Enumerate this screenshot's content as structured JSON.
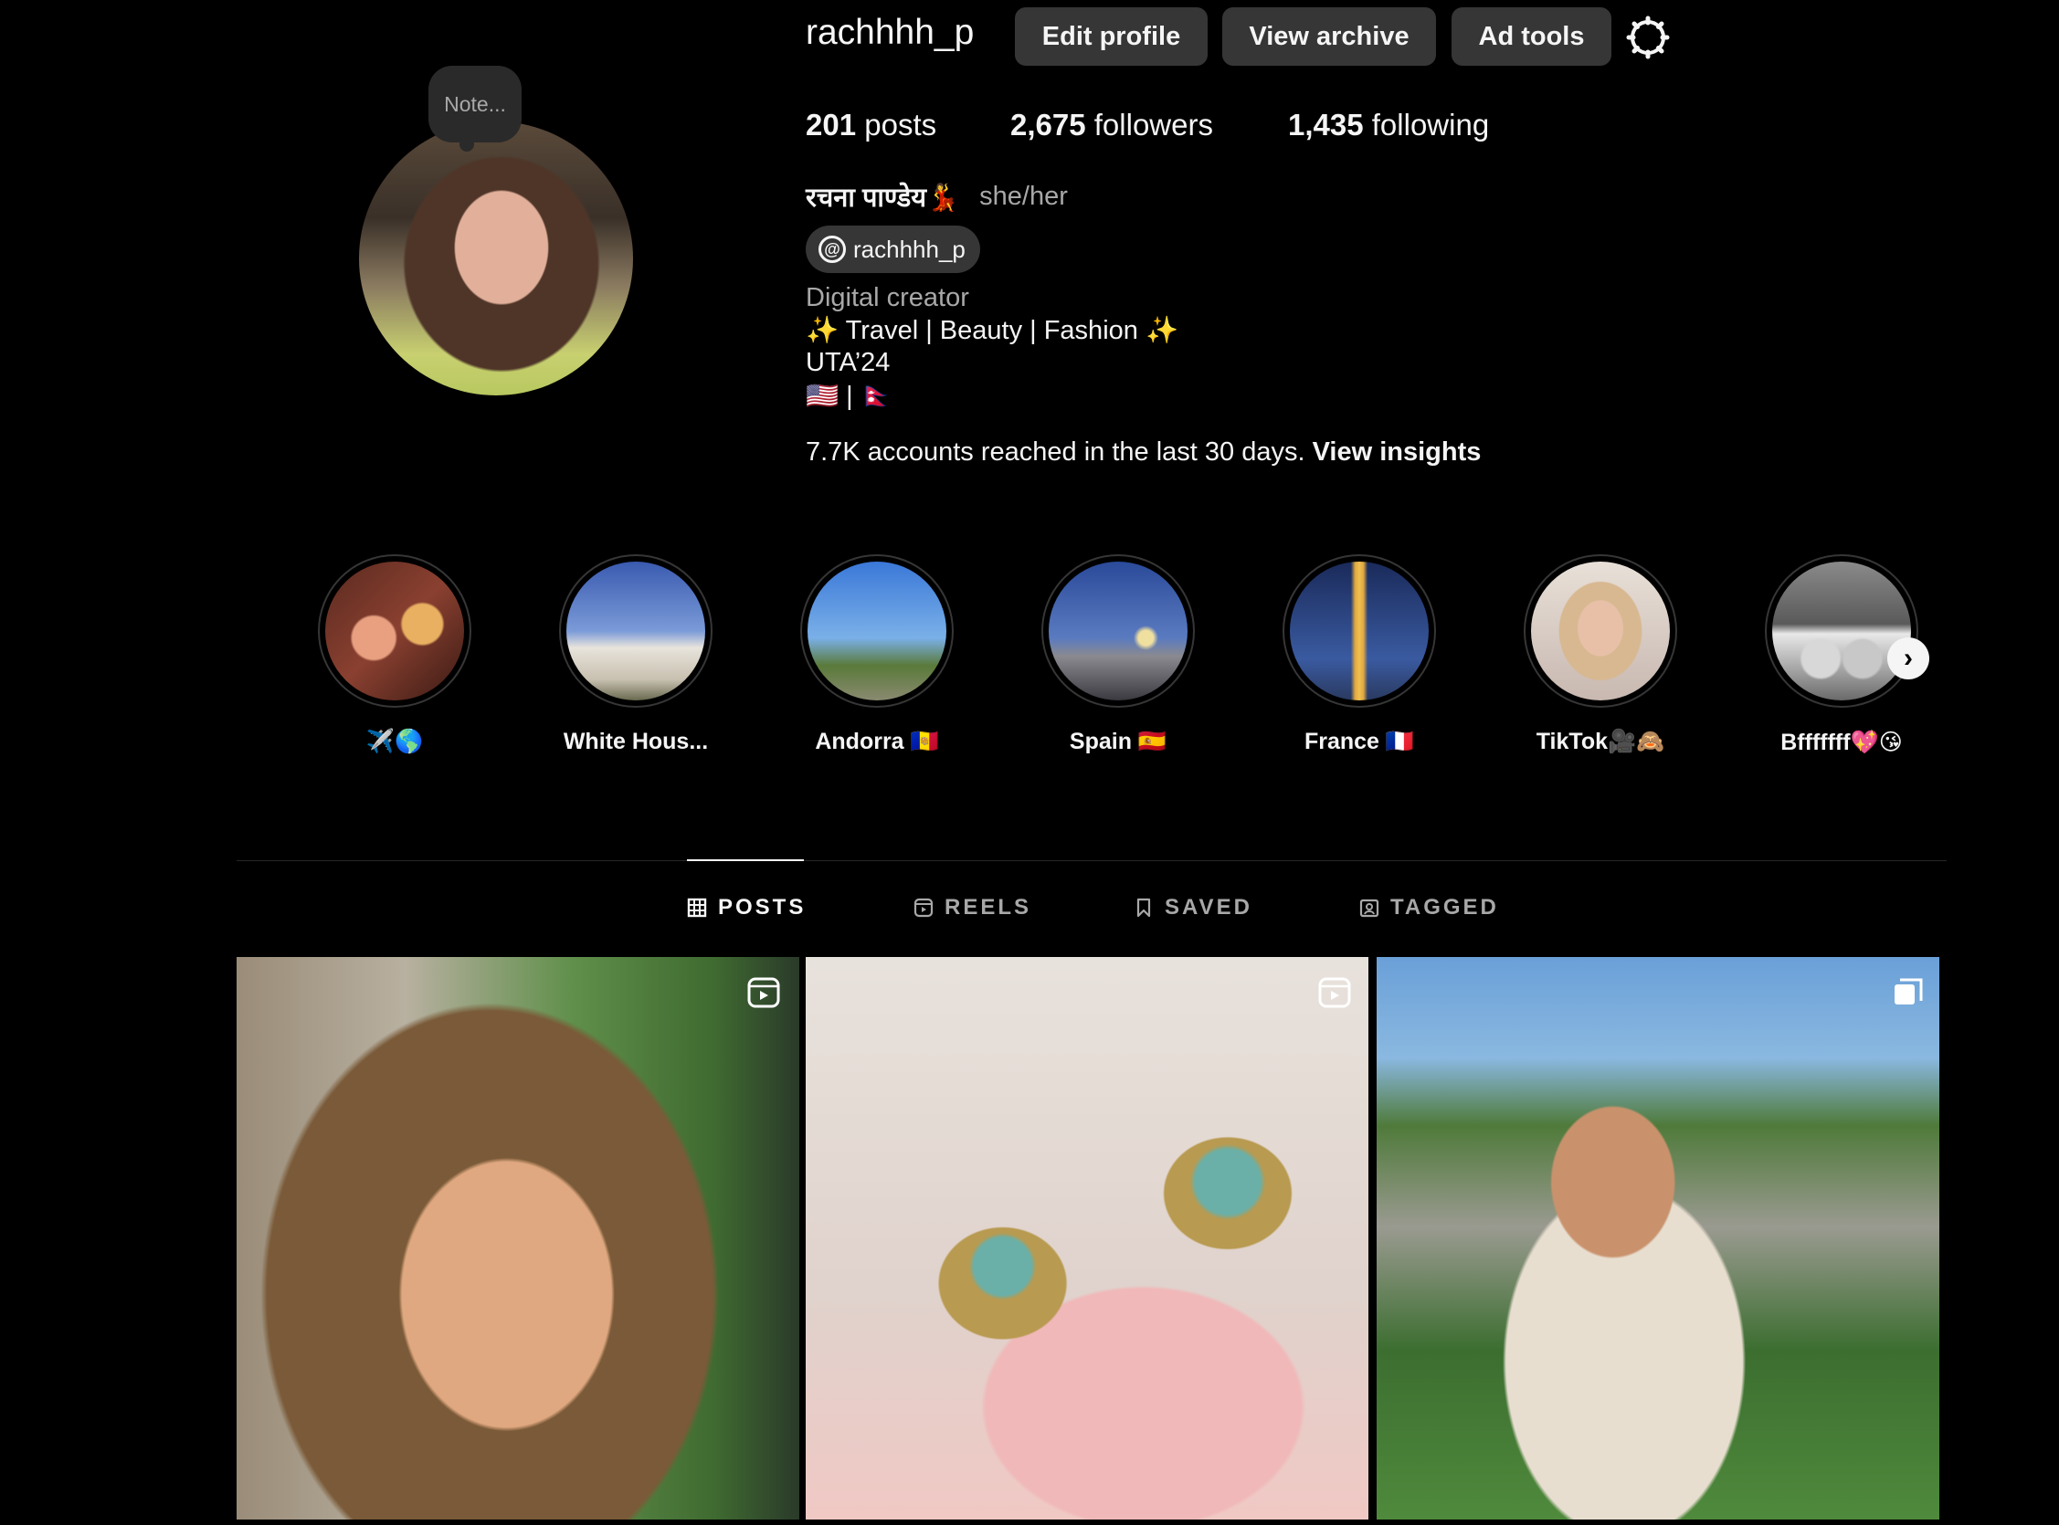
{
  "profile": {
    "username": "rachhhh_p",
    "note": "Note...",
    "fullname": "रचना पाण्डेय💃",
    "pronouns": "she/her",
    "threads_handle": "rachhhh_p",
    "category": "Digital creator",
    "bio_lines": [
      "✨ Travel | Beauty | Fashion ✨",
      "UTA’24",
      "🇺🇸 | 🇳🇵"
    ],
    "insights_text": "7.7K accounts reached in the last 30 days.",
    "insights_link": "View insights"
  },
  "actions": {
    "edit_profile": "Edit profile",
    "view_archive": "View archive",
    "ad_tools": "Ad tools",
    "settings_icon": "gear-icon"
  },
  "stats": {
    "posts_count": "201",
    "posts_label": "posts",
    "followers_count": "2,675",
    "followers_label": "followers",
    "following_count": "1,435",
    "following_label": "following"
  },
  "highlights": [
    {
      "label": "✈️🌎"
    },
    {
      "label": "White Hous..."
    },
    {
      "label": "Andorra 🇦🇩"
    },
    {
      "label": "Spain 🇪🇸"
    },
    {
      "label": "France 🇫🇷"
    },
    {
      "label": "TikTok🎥🙈"
    },
    {
      "label": "Bfffffff💖😘"
    }
  ],
  "tabs": {
    "posts": "POSTS",
    "reels": "REELS",
    "saved": "SAVED",
    "tagged": "TAGGED",
    "active": "posts"
  },
  "posts": [
    {
      "type_icon": "reel-icon"
    },
    {
      "type_icon": "reel-icon"
    },
    {
      "type_icon": "carousel-icon"
    }
  ],
  "colors": {
    "background": "#000000",
    "button": "#363636",
    "text_primary": "#f5f5f5",
    "text_secondary": "#a8a8a8",
    "divider": "#262626"
  }
}
